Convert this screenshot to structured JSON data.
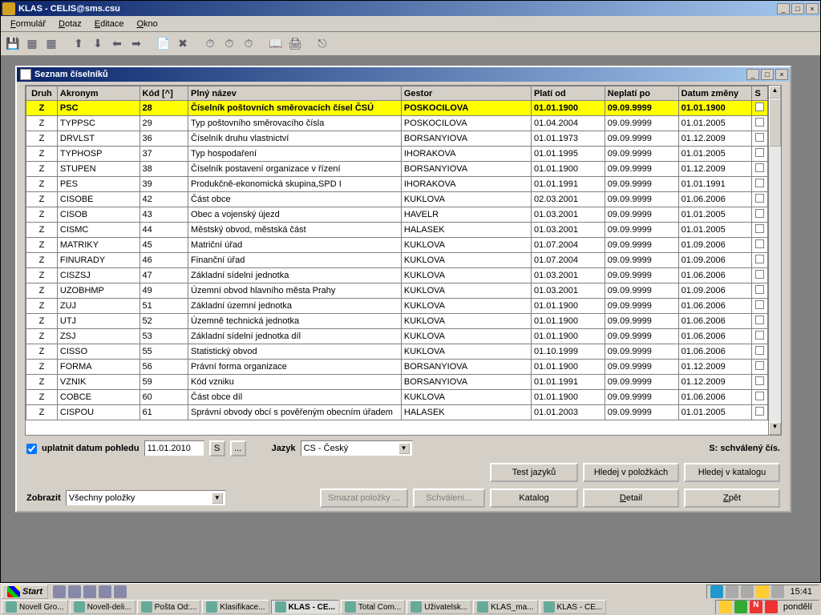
{
  "window": {
    "title": "KLAS - CELIS@sms.csu"
  },
  "menu": {
    "formular": "Formulář",
    "dotaz": "Dotaz",
    "editace": "Editace",
    "okno": "Okno"
  },
  "inner": {
    "title": "Seznam číselníků"
  },
  "columns": {
    "druh": "Druh",
    "akronym": "Akronym",
    "kod": "Kód [^]",
    "nazev": "Plný název",
    "gestor": "Gestor",
    "plati": "Platí od",
    "neplati": "Neplatí po",
    "zmena": "Datum změny",
    "s": "S"
  },
  "rows": [
    {
      "druh": "Z",
      "akronym": "PSC",
      "kod": "28",
      "nazev": "Číselník poštovních směrovacích čísel ČSÚ",
      "gestor": "POSKOCILOVA",
      "plati": "01.01.1900",
      "neplati": "09.09.9999",
      "zmena": "01.01.1900"
    },
    {
      "druh": "Z",
      "akronym": "TYPPSC",
      "kod": "29",
      "nazev": "Typ poštovního směrovacího čísla",
      "gestor": "POSKOCILOVA",
      "plati": "01.04.2004",
      "neplati": "09.09.9999",
      "zmena": "01.01.2005"
    },
    {
      "druh": "Z",
      "akronym": "DRVLST",
      "kod": "36",
      "nazev": "Číselník druhu vlastnictví",
      "gestor": "BORSANYIOVA",
      "plati": "01.01.1973",
      "neplati": "09.09.9999",
      "zmena": "01.12.2009"
    },
    {
      "druh": "Z",
      "akronym": "TYPHOSP",
      "kod": "37",
      "nazev": "Typ hospodaření",
      "gestor": "IHORAKOVA",
      "plati": "01.01.1995",
      "neplati": "09.09.9999",
      "zmena": "01.01.2005"
    },
    {
      "druh": "Z",
      "akronym": "STUPEN",
      "kod": "38",
      "nazev": "Číselník postavení organizace v řízení",
      "gestor": "BORSANYIOVA",
      "plati": "01.01.1900",
      "neplati": "09.09.9999",
      "zmena": "01.12.2009"
    },
    {
      "druh": "Z",
      "akronym": "PES",
      "kod": "39",
      "nazev": "Produkčně-ekonomická skupina,SPD I",
      "gestor": "IHORAKOVA",
      "plati": "01.01.1991",
      "neplati": "09.09.9999",
      "zmena": "01.01.1991"
    },
    {
      "druh": "Z",
      "akronym": "CISOBE",
      "kod": "42",
      "nazev": "Část obce",
      "gestor": "KUKLOVA",
      "plati": "02.03.2001",
      "neplati": "09.09.9999",
      "zmena": "01.06.2006"
    },
    {
      "druh": "Z",
      "akronym": "CISOB",
      "kod": "43",
      "nazev": "Obec a vojenský újezd",
      "gestor": "HAVELR",
      "plati": "01.03.2001",
      "neplati": "09.09.9999",
      "zmena": "01.01.2005"
    },
    {
      "druh": "Z",
      "akronym": "CISMC",
      "kod": "44",
      "nazev": "Městský obvod, městská část",
      "gestor": "HALASEK",
      "plati": "01.03.2001",
      "neplati": "09.09.9999",
      "zmena": "01.01.2005"
    },
    {
      "druh": "Z",
      "akronym": "MATRIKY",
      "kod": "45",
      "nazev": "Matriční úřad",
      "gestor": "KUKLOVA",
      "plati": "01.07.2004",
      "neplati": "09.09.9999",
      "zmena": "01.09.2006"
    },
    {
      "druh": "Z",
      "akronym": "FINURADY",
      "kod": "46",
      "nazev": "Finanční úřad",
      "gestor": "KUKLOVA",
      "plati": "01.07.2004",
      "neplati": "09.09.9999",
      "zmena": "01.09.2006"
    },
    {
      "druh": "Z",
      "akronym": "CISZSJ",
      "kod": "47",
      "nazev": "Základní sídelní jednotka",
      "gestor": "KUKLOVA",
      "plati": "01.03.2001",
      "neplati": "09.09.9999",
      "zmena": "01.06.2006"
    },
    {
      "druh": "Z",
      "akronym": "UZOBHMP",
      "kod": "49",
      "nazev": "Územní obvod hlavního města Prahy",
      "gestor": "KUKLOVA",
      "plati": "01.03.2001",
      "neplati": "09.09.9999",
      "zmena": "01.09.2006"
    },
    {
      "druh": "Z",
      "akronym": "ZUJ",
      "kod": "51",
      "nazev": "Základní územní jednotka",
      "gestor": "KUKLOVA",
      "plati": "01.01.1900",
      "neplati": "09.09.9999",
      "zmena": "01.06.2006"
    },
    {
      "druh": "Z",
      "akronym": "UTJ",
      "kod": "52",
      "nazev": "Územně technická jednotka",
      "gestor": "KUKLOVA",
      "plati": "01.01.1900",
      "neplati": "09.09.9999",
      "zmena": "01.06.2006"
    },
    {
      "druh": "Z",
      "akronym": "ZSJ",
      "kod": "53",
      "nazev": "Základní sídelní jednotka díl",
      "gestor": "KUKLOVA",
      "plati": "01.01.1900",
      "neplati": "09.09.9999",
      "zmena": "01.06.2006"
    },
    {
      "druh": "Z",
      "akronym": "CISSO",
      "kod": "55",
      "nazev": "Statistický obvod",
      "gestor": "KUKLOVA",
      "plati": "01.10.1999",
      "neplati": "09.09.9999",
      "zmena": "01.06.2006"
    },
    {
      "druh": "Z",
      "akronym": "FORMA",
      "kod": "56",
      "nazev": "Právní forma organizace",
      "gestor": "BORSANYIOVA",
      "plati": "01.01.1900",
      "neplati": "09.09.9999",
      "zmena": "01.12.2009"
    },
    {
      "druh": "Z",
      "akronym": "VZNIK",
      "kod": "59",
      "nazev": "Kód vzniku",
      "gestor": "BORSANYIOVA",
      "plati": "01.01.1991",
      "neplati": "09.09.9999",
      "zmena": "01.12.2009"
    },
    {
      "druh": "Z",
      "akronym": "COBCE",
      "kod": "60",
      "nazev": "Část obce díl",
      "gestor": "KUKLOVA",
      "plati": "01.01.1900",
      "neplati": "09.09.9999",
      "zmena": "01.06.2006"
    },
    {
      "druh": "Z",
      "akronym": "CISPOU",
      "kod": "61",
      "nazev": "Správní obvody obcí s pověřeným obecním úřadem",
      "gestor": "HALASEK",
      "plati": "01.01.2003",
      "neplati": "09.09.9999",
      "zmena": "01.01.2005"
    }
  ],
  "controls": {
    "uplatnit": "uplatnit datum pohledu",
    "datum": "11.01.2010",
    "s_btn": "S",
    "dots_btn": "...",
    "jazyk_lbl": "Jazyk",
    "jazyk_val": "CS - Český",
    "schvaleny": "S: schválený čís.",
    "test_jazyku": "Test jazyků",
    "hledej_polozky": "Hledej v položkách",
    "hledej_katalog": "Hledej v katalogu",
    "zobrazit_lbl": "Zobrazit",
    "zobrazit_val": "Všechny položky",
    "smazat": "Smazat položky ...",
    "schvaleni": "Schválení...",
    "katalog": "Katalog",
    "detail": "Detail",
    "zpet": "Zpět"
  },
  "taskbar": {
    "start": "Start",
    "clock": "15:41",
    "day": "pondělí",
    "tasks": [
      "Novell Gro...",
      "Novell-deli...",
      "Pošta Od:...",
      "Klasifikace...",
      "KLAS - CE...",
      "Total Com...",
      "Uživatelsk...",
      "KLAS_ma...",
      "KLAS - CE..."
    ]
  }
}
